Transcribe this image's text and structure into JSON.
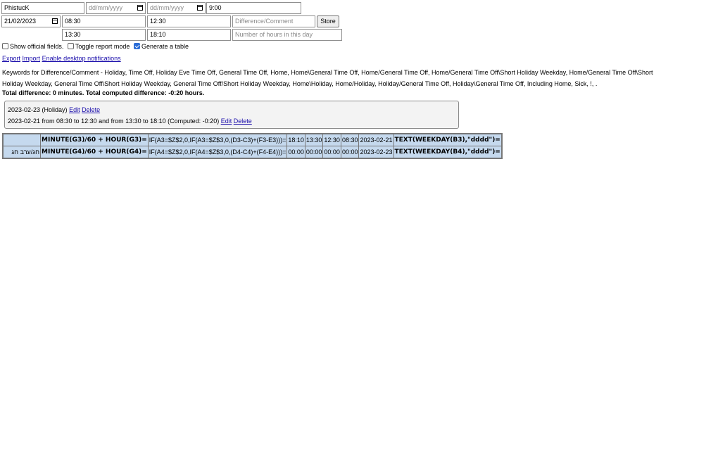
{
  "form": {
    "name_value": "PhistucK",
    "date_from_placeholder": "dd/mm/yyyy",
    "date_to_placeholder": "dd/mm/yyyy",
    "hours_value": "9:00",
    "entry_date_value": "21/02/2023",
    "start1_value": "08:30",
    "end1_value": "12:30",
    "comment_placeholder": "Difference/Comment",
    "store_label": "Store",
    "start2_value": "13:30",
    "end2_value": "18:10",
    "hours_in_day_placeholder": "Number of hours in this day"
  },
  "options": [
    {
      "label": "Show official fields.",
      "checked": false
    },
    {
      "label": "Toggle report mode",
      "checked": false
    },
    {
      "label": "Generate a table",
      "checked": true
    }
  ],
  "links": {
    "export": "Export",
    "import": "Import",
    "notifications": "Enable desktop notifications"
  },
  "keywords_line1": "Keywords for Difference/Comment - Holiday, Time Off, Holiday Eve Time Off, General Time Off, Home, Home\\General Time Off, Home/General Time Off, Home/General Time Off\\Short Holiday Weekday, Home/General Time Off\\Short",
  "keywords_line2": "Holiday Weekday, General Time Off\\Short Holiday Weekday, General Time Off/Short Holiday Weekday, Home\\Holiday, Home/Holiday, Holiday/General Time Off, Holiday\\General Time Off, Including Home, Sick, !, .",
  "total_summary": "Total difference: 0 minutes. Total computed difference: -0:20 hours.",
  "entries": [
    {
      "text": "2023-02-23 (Holiday)",
      "edit": "Edit",
      "delete": "Delete"
    },
    {
      "text": "2023-02-21 from 08:30 to 12:30 and from 13:30 to 18:10 (Computed: -0:20)",
      "edit": "Edit",
      "delete": "Delete"
    }
  ],
  "table": {
    "rows": [
      [
        "",
        "MINUTE(G3)/60 + HOUR(G3)=",
        "IF(A3=$Z$2,0,IF(A3=$Z$3,0,(D3-C3)+(F3-E3)))=",
        "18:10",
        "13:30",
        "12:30",
        "08:30",
        "2023-02-21",
        "TEXT(WEEKDAY(B3),\"dddd\")="
      ],
      [
        "חג/ערב חג",
        "MINUTE(G4)/60 + HOUR(G4)=",
        "IF(A4=$Z$2,0,IF(A4=$Z$3,0,(D4-C4)+(F4-E4)))=",
        "00:00",
        "00:00",
        "00:00",
        "00:00",
        "2023-02-23",
        "TEXT(WEEKDAY(B4),\"dddd\")="
      ]
    ]
  }
}
